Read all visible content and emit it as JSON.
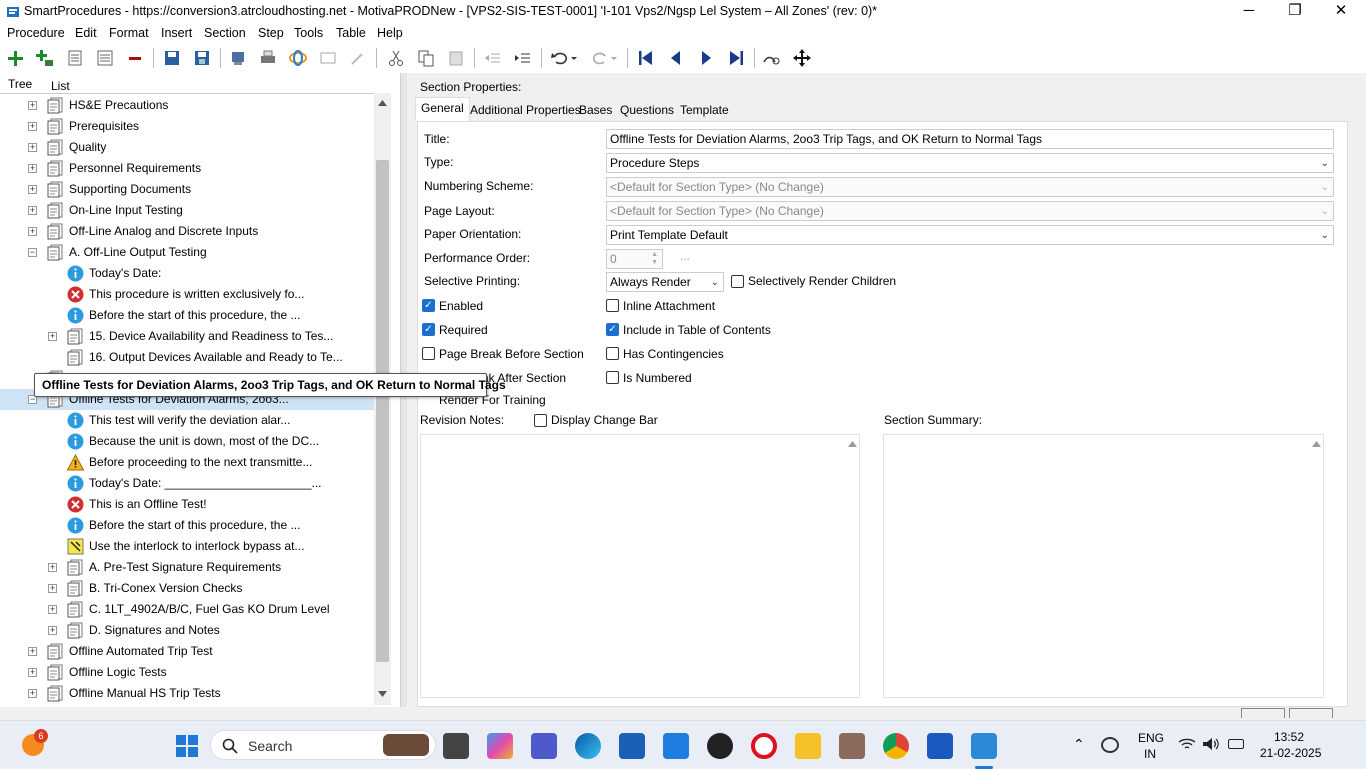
{
  "window": {
    "title": "SmartProcedures - https://conversion3.atrcloudhosting.net - MotivaPRODNew - [VPS2-SIS-TEST-0001] 'I-101 Vps2/Ngsp Lel System – All Zones' (rev: 0)*",
    "minimize": "─",
    "maximize": "❐",
    "close": "✕"
  },
  "menu": [
    "Procedure",
    "Edit",
    "Format",
    "Insert",
    "Section",
    "Step",
    "Tools",
    "Table",
    "Help"
  ],
  "left_tabs": {
    "tree": "Tree",
    "list": "List"
  },
  "tree": [
    {
      "level": 0,
      "exp": "+",
      "icon": "section-icon",
      "label": "HS&E Precautions"
    },
    {
      "level": 0,
      "exp": "+",
      "icon": "section-icon",
      "label": "Prerequisites"
    },
    {
      "level": 0,
      "exp": "+",
      "icon": "section-icon",
      "label": "Quality"
    },
    {
      "level": 0,
      "exp": "+",
      "icon": "section-icon",
      "label": "Personnel Requirements"
    },
    {
      "level": 0,
      "exp": "+",
      "icon": "section-icon",
      "label": "Supporting Documents"
    },
    {
      "level": 0,
      "exp": "+",
      "icon": "section-icon",
      "label": "On-Line Input Testing"
    },
    {
      "level": 0,
      "exp": "+",
      "icon": "section-icon",
      "label": "Off-Line Analog and Discrete Inputs"
    },
    {
      "level": 0,
      "exp": "−",
      "icon": "section-icon",
      "label": "A. Off-Line Output Testing"
    },
    {
      "level": 1,
      "exp": "",
      "icon": "info-icon",
      "label": "Today's Date:"
    },
    {
      "level": 1,
      "exp": "",
      "icon": "error-icon",
      "label": "This procedure is written exclusively fo..."
    },
    {
      "level": 1,
      "exp": "",
      "icon": "info-icon",
      "label": "Before the start of this procedure, the ..."
    },
    {
      "level": 1,
      "exp": "+",
      "icon": "section-icon",
      "label": "15. Device Availability and Readiness to Tes..."
    },
    {
      "level": 1,
      "exp": "",
      "icon": "section-icon",
      "label": "16. Output Devices Available and Ready to Te..."
    },
    {
      "level": 0,
      "exp": "",
      "icon": "section-icon",
      "label": ""
    },
    {
      "level": 0,
      "exp": "−",
      "icon": "section-icon",
      "label": "Offline Tests for Deviation Alarms, 2oo3...",
      "selected": true
    },
    {
      "level": 1,
      "exp": "",
      "icon": "info-icon",
      "label": "This test will verify the deviation alar..."
    },
    {
      "level": 1,
      "exp": "",
      "icon": "info-icon",
      "label": "Because the unit is down, most of the DC..."
    },
    {
      "level": 1,
      "exp": "",
      "icon": "warning-icon",
      "label": "Before proceeding to the next transmitte..."
    },
    {
      "level": 1,
      "exp": "",
      "icon": "info-icon",
      "label": "Today's Date: ______________________..."
    },
    {
      "level": 1,
      "exp": "",
      "icon": "error-icon",
      "label": "This is an Offline Test!"
    },
    {
      "level": 1,
      "exp": "",
      "icon": "info-icon",
      "label": "Before the start of this procedure, the ..."
    },
    {
      "level": 1,
      "exp": "",
      "icon": "interlock-icon",
      "label": "Use the interlock to interlock bypass at..."
    },
    {
      "level": 1,
      "exp": "+",
      "icon": "section-icon",
      "label": "A. Pre-Test Signature Requirements"
    },
    {
      "level": 1,
      "exp": "+",
      "icon": "section-icon",
      "label": "B. Tri-Conex Version Checks"
    },
    {
      "level": 1,
      "exp": "+",
      "icon": "section-icon",
      "label": "C. 1LT_4902A/B/C, Fuel Gas KO Drum Level"
    },
    {
      "level": 1,
      "exp": "+",
      "icon": "section-icon",
      "label": "D. Signatures and Notes"
    },
    {
      "level": 0,
      "exp": "+",
      "icon": "section-icon",
      "label": "Offline Automated Trip Test"
    },
    {
      "level": 0,
      "exp": "+",
      "icon": "section-icon",
      "label": "Offline Logic Tests"
    },
    {
      "level": 0,
      "exp": "+",
      "icon": "section-icon",
      "label": "Offline Manual HS Trip Tests"
    }
  ],
  "tooltip": "Offline Tests for Deviation Alarms, 2oo3 Trip Tags, and OK Return to Normal Tags",
  "section": {
    "header": "Section Properties:",
    "tabs": [
      "General",
      "Additional Properties",
      "Bases",
      "Questions",
      "Template"
    ],
    "title_label": "Title:",
    "title_value": "Offline Tests for Deviation Alarms, 2oo3 Trip Tags, and OK Return to Normal Tags",
    "type_label": "Type:",
    "type_value": "Procedure Steps",
    "numbering_label": "Numbering Scheme:",
    "numbering_value": "<Default for Section Type> (No Change)",
    "layout_label": "Page Layout:",
    "layout_value": "<Default for Section Type> (No Change)",
    "orientation_label": "Paper Orientation:",
    "orientation_value": "Print Template Default",
    "perf_label": "Performance Order:",
    "perf_value": "0",
    "perf_browse": "...",
    "selprint_label": "Selective Printing:",
    "selprint_value": "Always Render",
    "sel_children": "Selectively Render Children",
    "enabled": "Enabled",
    "inline": "Inline Attachment",
    "required": "Required",
    "toc": "Include in Table of Contents",
    "pagebreak_before": "Page Break Before Section",
    "contingencies": "Has Contingencies",
    "pagebreak_after_partial": "ak After Section",
    "numbered": "Is Numbered",
    "render_training_partial": "Render For Training",
    "revision_notes": "Revision Notes:",
    "change_bar": "Display Change Bar",
    "summary": "Section Summary:"
  },
  "taskbar": {
    "badge": "6",
    "search": "Search",
    "lang1": "ENG",
    "lang2": "IN",
    "time": "13:52",
    "date": "21-02-2025"
  }
}
